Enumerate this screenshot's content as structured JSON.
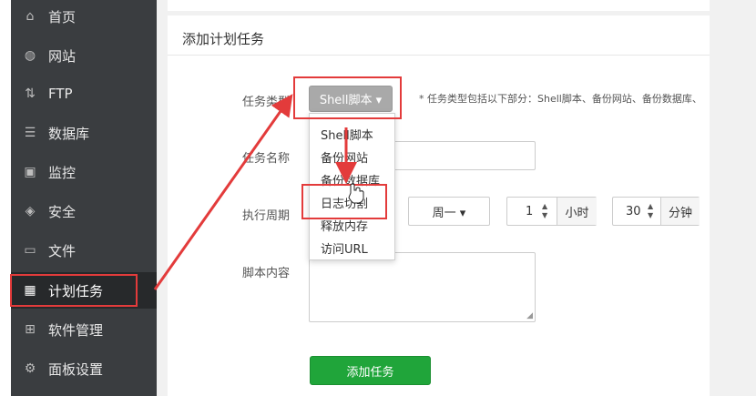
{
  "sidebar": {
    "items": [
      {
        "label": "首页",
        "icon": "home-icon",
        "glyph": "⌂"
      },
      {
        "label": "网站",
        "icon": "globe-icon",
        "glyph": "◍"
      },
      {
        "label": "FTP",
        "icon": "ftp-icon",
        "glyph": "⇅"
      },
      {
        "label": "数据库",
        "icon": "database-icon",
        "glyph": "☰"
      },
      {
        "label": "监控",
        "icon": "monitor-icon",
        "glyph": "▣"
      },
      {
        "label": "安全",
        "icon": "shield-icon",
        "glyph": "◈"
      },
      {
        "label": "文件",
        "icon": "folder-icon",
        "glyph": "▭"
      },
      {
        "label": "计划任务",
        "icon": "calendar-icon",
        "glyph": "▦"
      },
      {
        "label": "软件管理",
        "icon": "apps-icon",
        "glyph": "⊞"
      },
      {
        "label": "面板设置",
        "icon": "gear-icon",
        "glyph": "⚙"
      }
    ],
    "active_index": 7
  },
  "panel": {
    "title": "添加计划任务"
  },
  "form": {
    "task_type_label": "任务类型",
    "task_type_value": "Shell脚本 ▾",
    "task_type_hint": "*  任务类型包括以下部分：Shell脚本、备份网站、备份数据库、",
    "task_type_options": [
      "Shell脚本",
      "备份网站",
      "备份数据库",
      "日志切割",
      "释放内存",
      "访问URL"
    ],
    "task_name_label": "任务名称",
    "task_name_value": "",
    "period_label": "执行周期",
    "week_value": "周一 ▾",
    "hour_value": "1",
    "hour_unit": "小时",
    "minute_value": "30",
    "minute_unit": "分钟",
    "script_label": "脚本内容",
    "script_value": "",
    "submit_label": "添加任务"
  },
  "colors": {
    "sidebar_bg": "#3a3d40",
    "sidebar_active_bg": "#27292b",
    "accent_green": "#20a53a",
    "annotation_red": "#e33b3b"
  }
}
